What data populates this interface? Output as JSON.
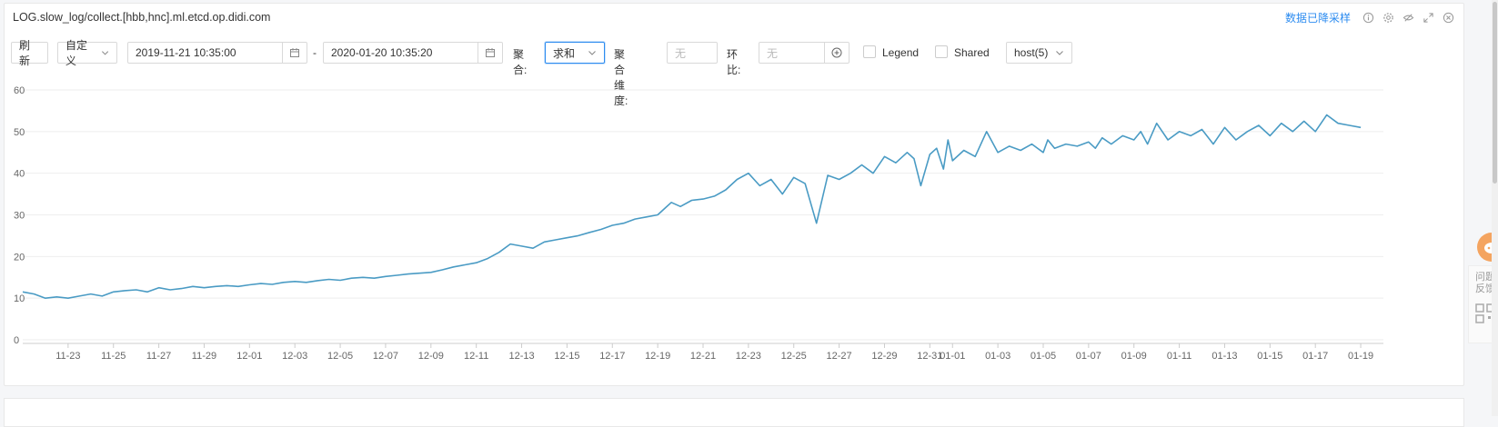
{
  "panel": {
    "title": "LOG.slow_log/collect.[hbb,hnc].ml.etcd.op.didi.com",
    "downsample_link": "数据已降采样",
    "icons": [
      "info-icon",
      "gear-icon",
      "eye-hide-icon",
      "expand-icon",
      "close-icon"
    ]
  },
  "toolbar": {
    "refresh": "刷 新",
    "range_mode": "自定义",
    "start_time": "2019-11-21 10:35:00",
    "dash": "-",
    "end_time": "2020-01-20 10:35:20",
    "agg_label": "聚合:",
    "agg_value": "求和",
    "agg_dim_label": "聚合维度:",
    "agg_dim_placeholder": "无",
    "compare_label": "环比:",
    "compare_placeholder": "无",
    "legend_label": "Legend",
    "shared_label": "Shared",
    "host_select": "host(5)"
  },
  "side": {
    "feedback": "问题反馈"
  },
  "colors": {
    "series": "#4a9bc4",
    "grid": "#eeeeee",
    "link": "#2d8cf0"
  },
  "chart_data": {
    "type": "line",
    "title": "",
    "xlabel": "",
    "ylabel": "",
    "ylim": [
      0,
      60
    ],
    "y_ticks": [
      0,
      10,
      20,
      30,
      40,
      50,
      60
    ],
    "x_ticks": [
      "11-23",
      "11-25",
      "11-27",
      "11-29",
      "12-01",
      "12-03",
      "12-05",
      "12-07",
      "12-09",
      "12-11",
      "12-13",
      "12-15",
      "12-17",
      "12-19",
      "12-21",
      "12-23",
      "12-25",
      "12-27",
      "12-29",
      "12-31",
      "01-01",
      "01-03",
      "01-05",
      "01-07",
      "01-09",
      "01-11",
      "01-13",
      "01-15",
      "01-17",
      "01-19"
    ],
    "x_tick_days": [
      2,
      4,
      6,
      8,
      10,
      12,
      14,
      16,
      18,
      20,
      22,
      24,
      26,
      28,
      30,
      32,
      34,
      36,
      38,
      40,
      41,
      43,
      45,
      47,
      49,
      51,
      53,
      55,
      57,
      59
    ],
    "grid": true,
    "series": [
      {
        "x_days": [
          0,
          0.5,
          1,
          1.5,
          2,
          2.5,
          3,
          3.5,
          4,
          4.5,
          5,
          5.5,
          6,
          6.5,
          7,
          7.5,
          8,
          8.5,
          9,
          9.5,
          10,
          10.5,
          11,
          11.5,
          12,
          12.5,
          13,
          13.5,
          14,
          14.5,
          15,
          15.5,
          16,
          16.5,
          17,
          17.5,
          18,
          18.5,
          19,
          19.5,
          20,
          20.5,
          21,
          21.5,
          22,
          22.5,
          23,
          23.5,
          24,
          24.5,
          25,
          25.5,
          26,
          26.5,
          27,
          27.5,
          28,
          28.3,
          28.6,
          29,
          29.5,
          30,
          30.5,
          31,
          31.5,
          32,
          32.5,
          33,
          33.5,
          34,
          34.5,
          35,
          35.5,
          36,
          36.5,
          37,
          37.5,
          38,
          38.5,
          39,
          39.3,
          39.6,
          40,
          40.3,
          40.6,
          40.8,
          41,
          41.5,
          42,
          42.5,
          43,
          43.5,
          44,
          44.5,
          45,
          45.2,
          45.5,
          46,
          46.5,
          47,
          47.3,
          47.6,
          48,
          48.5,
          49,
          49.3,
          49.6,
          50,
          50.5,
          51,
          51.5,
          52,
          52.5,
          53,
          53.5,
          54,
          54.5,
          55,
          55.5,
          56,
          56.5,
          57,
          57.5,
          58,
          58.5,
          59,
          59.5,
          59.8,
          60
        ],
        "values": [
          11.5,
          11,
          10,
          10.3,
          10,
          10.5,
          11,
          10.5,
          11.5,
          11.8,
          12,
          11.5,
          12.5,
          12,
          12.3,
          12.8,
          12.5,
          12.8,
          13,
          12.8,
          13.2,
          13.5,
          13.3,
          13.8,
          14,
          13.8,
          14.2,
          14.5,
          14.3,
          14.8,
          15,
          14.8,
          15.2,
          15.5,
          15.8,
          16,
          16.2,
          16.8,
          17.5,
          18,
          18.5,
          19.5,
          21,
          23,
          22.5,
          22,
          23.5,
          24,
          24.5,
          25,
          25.8,
          26.5,
          27.5,
          28,
          29,
          29.5,
          30,
          31.5,
          33,
          32,
          33.5,
          33.8,
          34.5,
          36,
          38.5,
          40,
          37,
          38.5,
          35,
          39,
          37.5,
          28,
          39.5,
          38.5,
          40,
          42,
          40,
          44,
          42.5,
          45,
          43.5,
          37,
          44.5,
          46,
          41,
          48,
          43,
          45.5,
          44,
          50,
          45,
          46.5,
          45.5,
          47,
          45,
          48,
          46,
          47,
          46.5,
          47.5,
          46,
          48.5,
          47,
          49,
          48,
          50,
          47,
          52,
          48,
          50,
          49,
          50.5,
          47,
          51,
          48,
          50,
          51.5,
          49,
          52,
          50,
          52.5,
          50,
          54,
          52,
          51.5,
          51
        ]
      }
    ]
  }
}
